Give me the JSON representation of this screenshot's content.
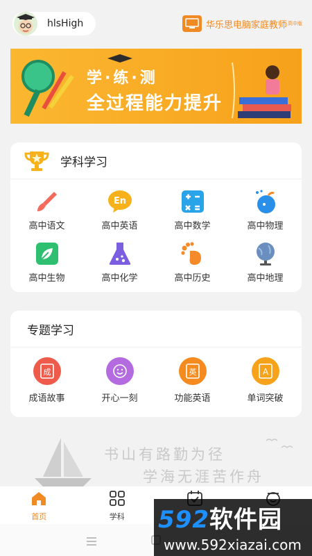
{
  "header": {
    "username": "hlsHigh",
    "brand_name": "华乐思电脑家庭教师",
    "brand_edition": "高中版"
  },
  "banner": {
    "line1": "学·练·测",
    "line2": "全过程能力提升"
  },
  "subjects": {
    "title": "学科学习",
    "items": [
      {
        "label": "高中语文",
        "icon": "brush-icon",
        "color": "#f26b5b"
      },
      {
        "label": "高中英语",
        "icon": "en-bubble-icon",
        "color": "#f7b21b"
      },
      {
        "label": "高中数学",
        "icon": "calculator-icon",
        "color": "#2aa4e8"
      },
      {
        "label": "高中物理",
        "icon": "apple-icon",
        "color": "#2a8fe8"
      },
      {
        "label": "高中生物",
        "icon": "leaf-icon",
        "color": "#2fbf71"
      },
      {
        "label": "高中化学",
        "icon": "flask-icon",
        "color": "#7b5fe0"
      },
      {
        "label": "高中历史",
        "icon": "footprint-icon",
        "color": "#f58a2a"
      },
      {
        "label": "高中地理",
        "icon": "globe-icon",
        "color": "#6a8fbf"
      }
    ]
  },
  "topics": {
    "title": "专题学习",
    "items": [
      {
        "label": "成语故事",
        "icon": "book-icon",
        "color": "#ef5b4b",
        "glyph": "成"
      },
      {
        "label": "开心一刻",
        "icon": "smile-icon",
        "color": "#b56be0",
        "glyph": "☺"
      },
      {
        "label": "功能英语",
        "icon": "english-book-icon",
        "color": "#f58a1f",
        "glyph": "英"
      },
      {
        "label": "单词突破",
        "icon": "letter-a-icon",
        "color": "#f7a21b",
        "glyph": "A"
      }
    ]
  },
  "slogan": {
    "line1": "书山有路勤为径",
    "line2": "学海无涯苦作舟"
  },
  "tabbar": {
    "items": [
      {
        "label": "首页",
        "icon": "home-icon",
        "active": true
      },
      {
        "label": "学科",
        "icon": "grid-icon",
        "active": false
      },
      {
        "label": "",
        "icon": "calendar-icon",
        "active": false
      },
      {
        "label": "",
        "icon": "profile-icon",
        "active": false
      }
    ]
  },
  "watermark": {
    "line1_num": "592",
    "line1_text": "软件园",
    "line2": "www.592xiazai.com"
  }
}
